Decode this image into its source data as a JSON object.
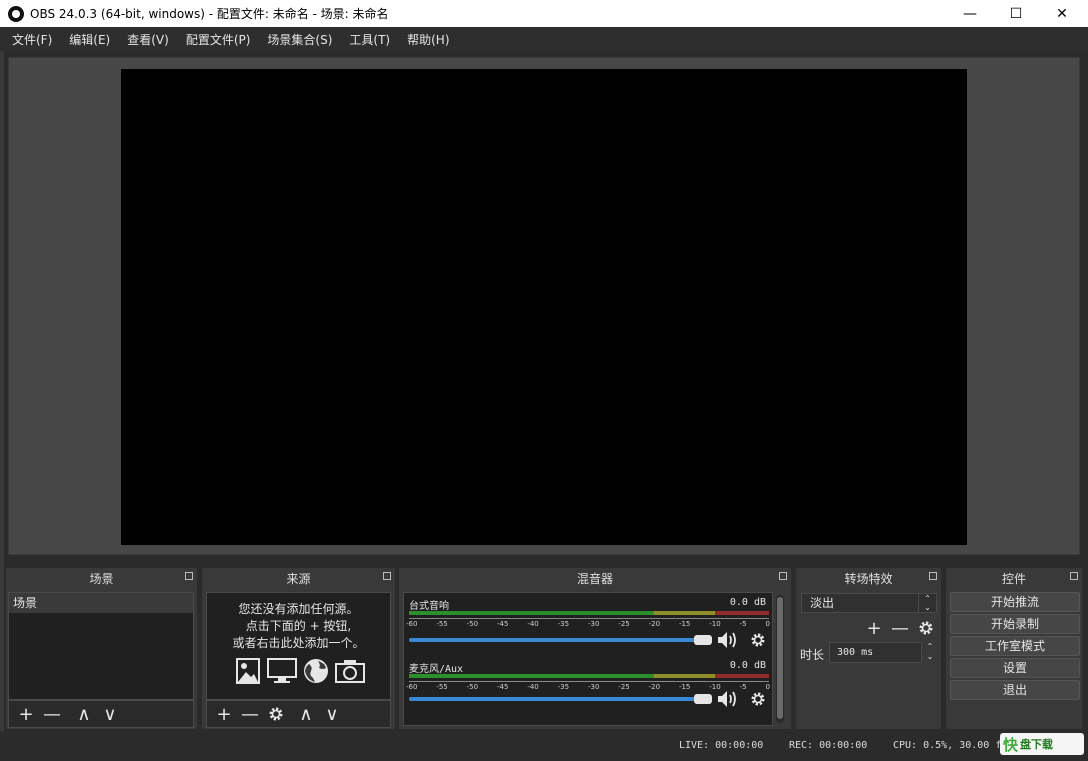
{
  "window": {
    "title": "OBS 24.0.3 (64-bit, windows) - 配置文件: 未命名 - 场景: 未命名",
    "minimize": "—",
    "maximize": "☐",
    "close": "✕"
  },
  "menu": [
    "文件(F)",
    "编辑(E)",
    "查看(V)",
    "配置文件(P)",
    "场景集合(S)",
    "工具(T)",
    "帮助(H)"
  ],
  "docks": {
    "scenes": {
      "title": "场景",
      "items": [
        "场景"
      ]
    },
    "sources": {
      "title": "来源",
      "hint_lines": [
        "您还没有添加任何源。",
        "点击下面的 + 按钮,",
        "或者右击此处添加一个。"
      ]
    },
    "mixer": {
      "title": "混音器",
      "channels": [
        {
          "name": "台式音响",
          "db": "0.0 dB",
          "volume_pct": 100
        },
        {
          "name": "麦克风/Aux",
          "db": "0.0 dB",
          "volume_pct": 100
        }
      ],
      "tick_labels": [
        "-60",
        "-55",
        "-50",
        "-45",
        "-40",
        "-35",
        "-30",
        "-25",
        "-20",
        "-15",
        "-10",
        "-5",
        "0"
      ]
    },
    "transitions": {
      "title": "转场特效",
      "selected": "淡出",
      "duration_label": "时长",
      "duration_value": "300 ms"
    },
    "controls": {
      "title": "控件",
      "buttons": [
        "开始推流",
        "开始录制",
        "工作室模式",
        "设置",
        "退出"
      ]
    }
  },
  "toolbar_icons": {
    "add": "+",
    "remove": "—",
    "up": "∧",
    "down": "∨"
  },
  "status": {
    "live": "LIVE: 00:00:00",
    "rec": "REC: 00:00:00",
    "cpu": "CPU: 0.5%, 30.00 fps"
  },
  "watermark": {
    "a": "快",
    "b": "盘下载"
  },
  "colors": {
    "meter_green": "#2b8f2b",
    "meter_yellow": "#8f8f2b",
    "meter_red": "#8f2b2b",
    "slider_blue": "#3a88d6"
  }
}
